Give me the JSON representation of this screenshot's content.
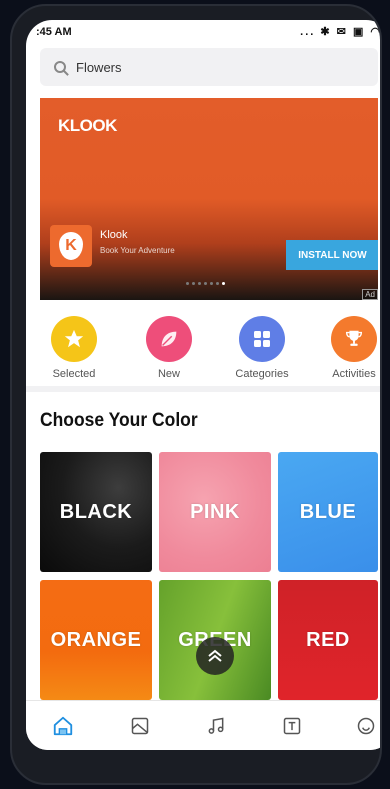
{
  "status": {
    "time": ":45 AM",
    "icons": "... ✱ ✉ ▣ ◠"
  },
  "search": {
    "placeholder": "Flowers"
  },
  "banner": {
    "brand_logo": "KLOOK",
    "app_name": "Klook",
    "tagline": "Book Your Adventure",
    "install_label": "INSTALL NOW",
    "ad_label": "Ad",
    "app_icon_letter": "K",
    "page_count": 7,
    "active_page": 7
  },
  "categories": [
    {
      "label": "Selected",
      "icon": "star-icon",
      "color": "#f5c518"
    },
    {
      "label": "New",
      "icon": "leaf-icon",
      "color": "#ee4e7a"
    },
    {
      "label": "Categories",
      "icon": "grid-icon",
      "color": "#5f7ee6"
    },
    {
      "label": "Activities",
      "icon": "trophy-icon",
      "color": "#f47a2d"
    }
  ],
  "section": {
    "title": "Choose Your Color"
  },
  "colors": [
    {
      "label": "BLACK"
    },
    {
      "label": "PINK"
    },
    {
      "label": "BLUE"
    },
    {
      "label": "ORANGE"
    },
    {
      "label": "GREEN"
    },
    {
      "label": "RED"
    }
  ],
  "scroll_top_icon": "double-chevron-up-icon",
  "bottom_nav": [
    {
      "icon": "home-icon",
      "active": true
    },
    {
      "icon": "image-icon",
      "active": false
    },
    {
      "icon": "music-icon",
      "active": false
    },
    {
      "icon": "text-icon",
      "active": false
    },
    {
      "icon": "smile-icon",
      "active": false
    }
  ],
  "accent_color": "#1f8fe0"
}
